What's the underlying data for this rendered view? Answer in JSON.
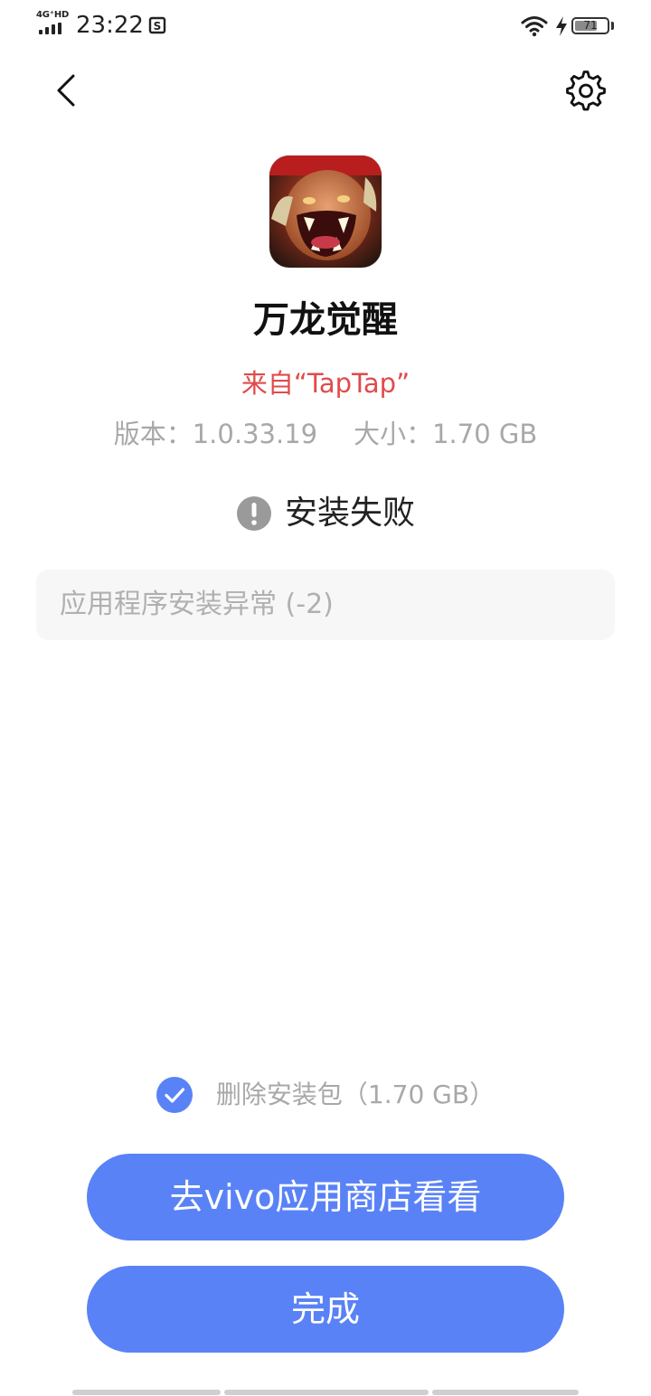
{
  "status_bar": {
    "network": "4G⁺HD",
    "time": "23:22",
    "battery_level": "71",
    "battery_fraction": 0.71
  },
  "nav": {
    "back_icon": "chevron-left-icon",
    "settings_icon": "gear-icon"
  },
  "app": {
    "name": "万龙觉醒",
    "source": "来自“TapTap”",
    "version_label": "版本：1.0.33.19",
    "size_label": "大小：1.70 GB"
  },
  "install": {
    "status": "安装失败",
    "status_icon": "exclamation-circle-icon",
    "error_message": "应用程序安装异常 (-2)",
    "delete_package_label": "删除安装包（1.70 GB）",
    "delete_package_checked": true
  },
  "actions": {
    "store_button": "去vivo应用商店看看",
    "done_button": "完成"
  },
  "colors": {
    "accent": "#5a82f7",
    "source_red": "#e04b4b",
    "muted_text": "#a8a8a8",
    "error_box_bg": "#f7f7f7"
  }
}
